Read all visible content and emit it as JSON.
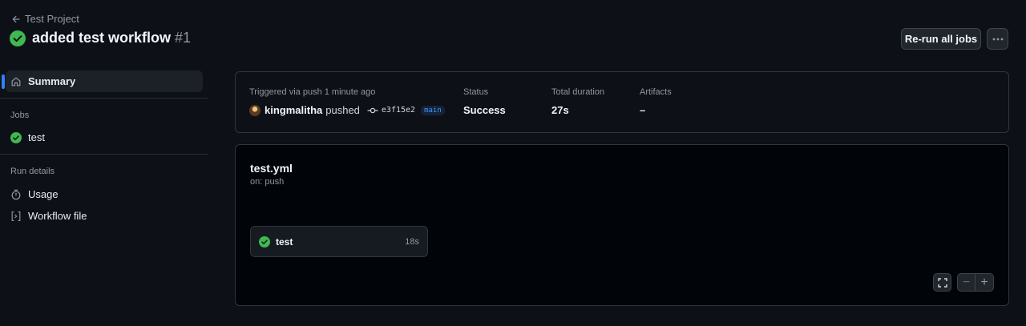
{
  "header": {
    "back_label": "Test Project",
    "title": "added test workflow",
    "run_number": "#1",
    "rerun_label": "Re-run all jobs",
    "more_label": "···"
  },
  "sidebar": {
    "summary_label": "Summary",
    "jobs_heading": "Jobs",
    "jobs": [
      {
        "label": "test",
        "status": "success"
      }
    ],
    "run_details_heading": "Run details",
    "usage_label": "Usage",
    "workflow_file_label": "Workflow file"
  },
  "summary": {
    "trigger_label": "Triggered via push 1 minute ago",
    "user": "kingmalitha",
    "action": "pushed",
    "commit_sha": "e3f15e2",
    "branch": "main",
    "status_label": "Status",
    "status_value": "Success",
    "duration_label": "Total duration",
    "duration_value": "27s",
    "artifacts_label": "Artifacts",
    "artifacts_value": "–"
  },
  "graph": {
    "workflow_file": "test.yml",
    "trigger": "on: push",
    "job": {
      "name": "test",
      "duration": "18s",
      "status": "success"
    },
    "zoom_out_label": "−",
    "zoom_in_label": "+"
  },
  "colors": {
    "background": "#0d1117",
    "success": "#3fb950",
    "accent": "#2f81f7"
  }
}
